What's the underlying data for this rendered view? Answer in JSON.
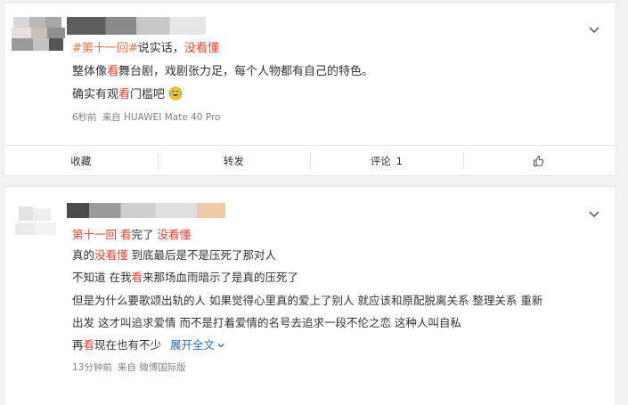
{
  "posts": [
    {
      "tag_topic": "#第十一回#",
      "title_rest": "说实话，",
      "title_tag": "没看懂",
      "body_line1_a": "整体像",
      "body_line1_kw": "看",
      "body_line1_b": "舞台剧，戏剧张力足，每个人物都有自己的特色。",
      "body_line2_a": "确实有观",
      "body_line2_kw": "看",
      "body_line2_b": "门槛吧",
      "time": "6秒前",
      "source": "来自 HUAWEI Mate 40 Pro",
      "actions": {
        "favorite": "收藏",
        "repost": "转发",
        "comment": "评论",
        "comment_count": "1"
      }
    },
    {
      "tag_episode": "第十一回",
      "tag_watch_kw": "看",
      "tag_watch_rest": "完了",
      "tag_notunderstood": "没看懂",
      "l1_a": "真的",
      "l1_b": "没看懂",
      "l1_c": " 到底最后是不是压死了那对人",
      "l2_a": "不知道 在我",
      "l2_kw": "看",
      "l2_b": "来那场血雨暗示了是真的压死了",
      "l3": "但是为什么要歌颂出轨的人 如果觉得心里真的爱上了别人 就应该和原配脱离关系 整理关系 重新",
      "l4": "出发 这才叫追求爱情 而不是打着爱情的名号去追求一段不伦之恋 这种人叫自私",
      "l5_a": "再",
      "l5_kw": "看",
      "l5_b": "现在也有不少",
      "expand": "展开全文",
      "time": "13分钟前",
      "source": "来自 微博国际版"
    }
  ],
  "icons": {
    "chevron": "chevron-down-icon",
    "like": "thumbs-up-icon",
    "emoji": "laugh-cry-emoji-icon",
    "expand": "chevron-small-down-icon"
  },
  "colors": {
    "keyword": "#e8412f",
    "topic": "#eb7350",
    "expand": "#2d6fb7"
  }
}
